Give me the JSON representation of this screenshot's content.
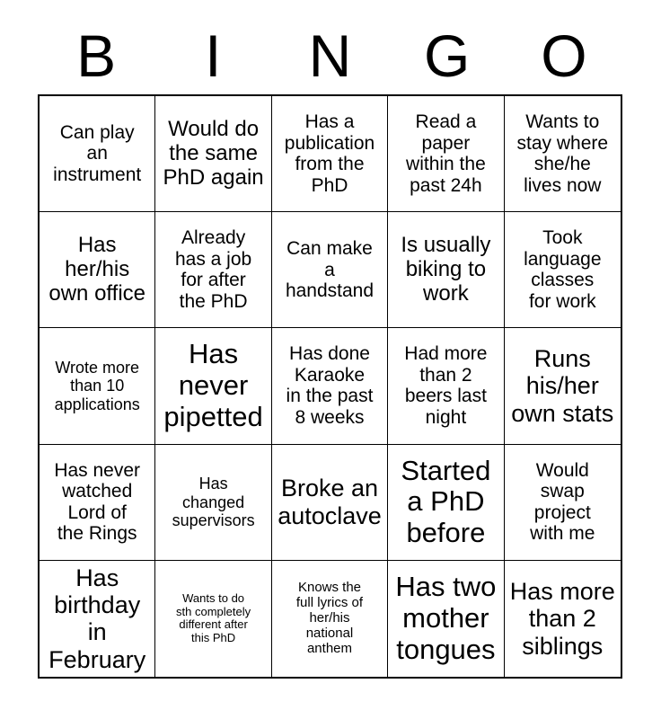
{
  "header": {
    "letters": [
      "B",
      "I",
      "N",
      "G",
      "O"
    ]
  },
  "grid": {
    "rows": 5,
    "columns": 5,
    "border_color": "#000000",
    "cell_background": "#ffffff",
    "cells": [
      {
        "text": "Can play\nan\ninstrument",
        "size": "md"
      },
      {
        "text": "Would do\nthe same\nPhD again",
        "size": "lg"
      },
      {
        "text": "Has a\npublication\nfrom the\nPhD",
        "size": "md"
      },
      {
        "text": "Read a\npaper\nwithin the\npast 24h",
        "size": "md"
      },
      {
        "text": "Wants to\nstay where\nshe/he\nlives now",
        "size": "md"
      },
      {
        "text": "Has\nher/his\nown office",
        "size": "lg"
      },
      {
        "text": "Already\nhas a job\nfor after\nthe PhD",
        "size": "md"
      },
      {
        "text": "Can make\na\nhandstand",
        "size": "md"
      },
      {
        "text": "Is usually\nbiking to\nwork",
        "size": "lg"
      },
      {
        "text": "Took\nlanguage\nclasses\nfor work",
        "size": "md"
      },
      {
        "text": "Wrote more\nthan 10\napplications",
        "size": "sm"
      },
      {
        "text": "Has\nnever\npipetted",
        "size": "xxl"
      },
      {
        "text": "Has done\nKaraoke\nin the past\n8 weeks",
        "size": "md"
      },
      {
        "text": "Had more\nthan 2\nbeers last\nnight",
        "size": "md"
      },
      {
        "text": "Runs\nhis/her\nown stats",
        "size": "xl"
      },
      {
        "text": "Has never\nwatched\nLord of\nthe Rings",
        "size": "md"
      },
      {
        "text": "Has\nchanged\nsupervisors",
        "size": "sm"
      },
      {
        "text": "Broke an\nautoclave",
        "size": "xl"
      },
      {
        "text": "Started\na PhD\nbefore",
        "size": "xxl"
      },
      {
        "text": "Would\nswap\nproject\nwith me",
        "size": "md"
      },
      {
        "text": "Has\nbirthday in\nFebruary",
        "size": "xl"
      },
      {
        "text": "Wants to do\nsth completely\ndifferent after\nthis PhD",
        "size": "xxs"
      },
      {
        "text": "Knows the\nfull lyrics of\nher/his\nnational\nanthem",
        "size": "xs"
      },
      {
        "text": "Has two\nmother\ntongues",
        "size": "xxl"
      },
      {
        "text": "Has more\nthan 2\nsiblings",
        "size": "xl"
      }
    ]
  }
}
